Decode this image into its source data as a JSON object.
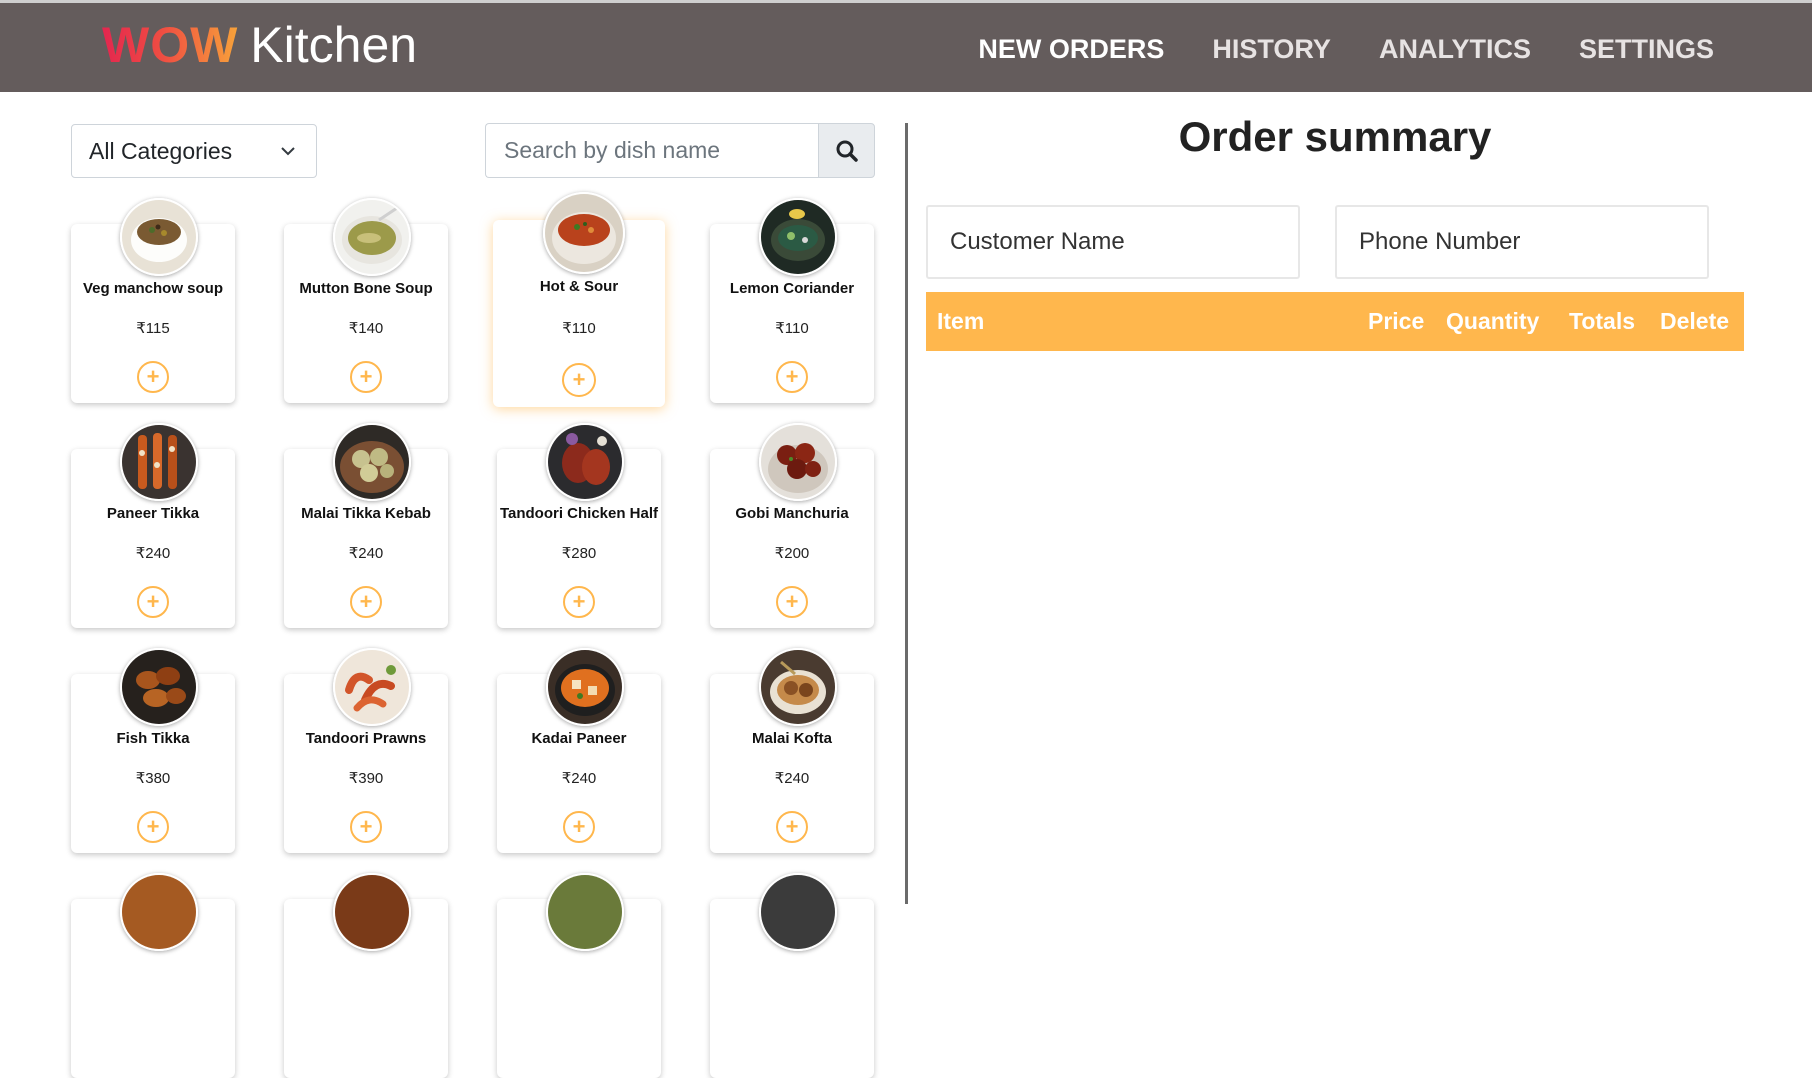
{
  "app": {
    "brand_part1": "WOW",
    "brand_part2": "Kitchen",
    "nav": [
      {
        "label": "NEW ORDERS",
        "active": true
      },
      {
        "label": "HISTORY",
        "active": false
      },
      {
        "label": "ANALYTICS",
        "active": false
      },
      {
        "label": "SETTINGS",
        "active": false
      }
    ]
  },
  "filters": {
    "category": "All Categories",
    "search_placeholder": "Search by dish name"
  },
  "menu": {
    "currency": "₹",
    "items": [
      {
        "name": "Veg manchow soup",
        "price": "₹115",
        "icon": "soup-bowl"
      },
      {
        "name": "Mutton Bone Soup",
        "price": "₹140",
        "icon": "soup-bowl"
      },
      {
        "name": "Hot & Sour",
        "price": "₹110",
        "icon": "soup-bowl"
      },
      {
        "name": "Lemon Coriander",
        "price": "₹110",
        "icon": "soup-bowl"
      },
      {
        "name": "Paneer Tikka",
        "price": "₹240",
        "icon": "skewer-plate"
      },
      {
        "name": "Malai Tikka Kebab",
        "price": "₹240",
        "icon": "kebab-plate"
      },
      {
        "name": "Tandoori Chicken Half",
        "price": "₹280",
        "icon": "chicken-plate"
      },
      {
        "name": "Gobi Manchuria",
        "price": "₹200",
        "icon": "manchurian-bowl"
      },
      {
        "name": "Fish Tikka",
        "price": "₹380",
        "icon": "fish-plate"
      },
      {
        "name": "Tandoori Prawns",
        "price": "₹390",
        "icon": "prawn-plate"
      },
      {
        "name": "Kadai Paneer",
        "price": "₹240",
        "icon": "curry-bowl"
      },
      {
        "name": "Malai Kofta",
        "price": "₹240",
        "icon": "kofta-bowl"
      }
    ]
  },
  "order": {
    "title": "Order summary",
    "customer_placeholder": "Customer Name",
    "phone_placeholder": "Phone Number",
    "columns": [
      "Item",
      "Price",
      "Quantity",
      "Totals",
      "Delete"
    ]
  },
  "colors": {
    "navbar": "#645c5c",
    "accent": "#ffb74d",
    "brand_gradient_start": "#e3264f",
    "brand_gradient_end": "#f7a23a"
  }
}
